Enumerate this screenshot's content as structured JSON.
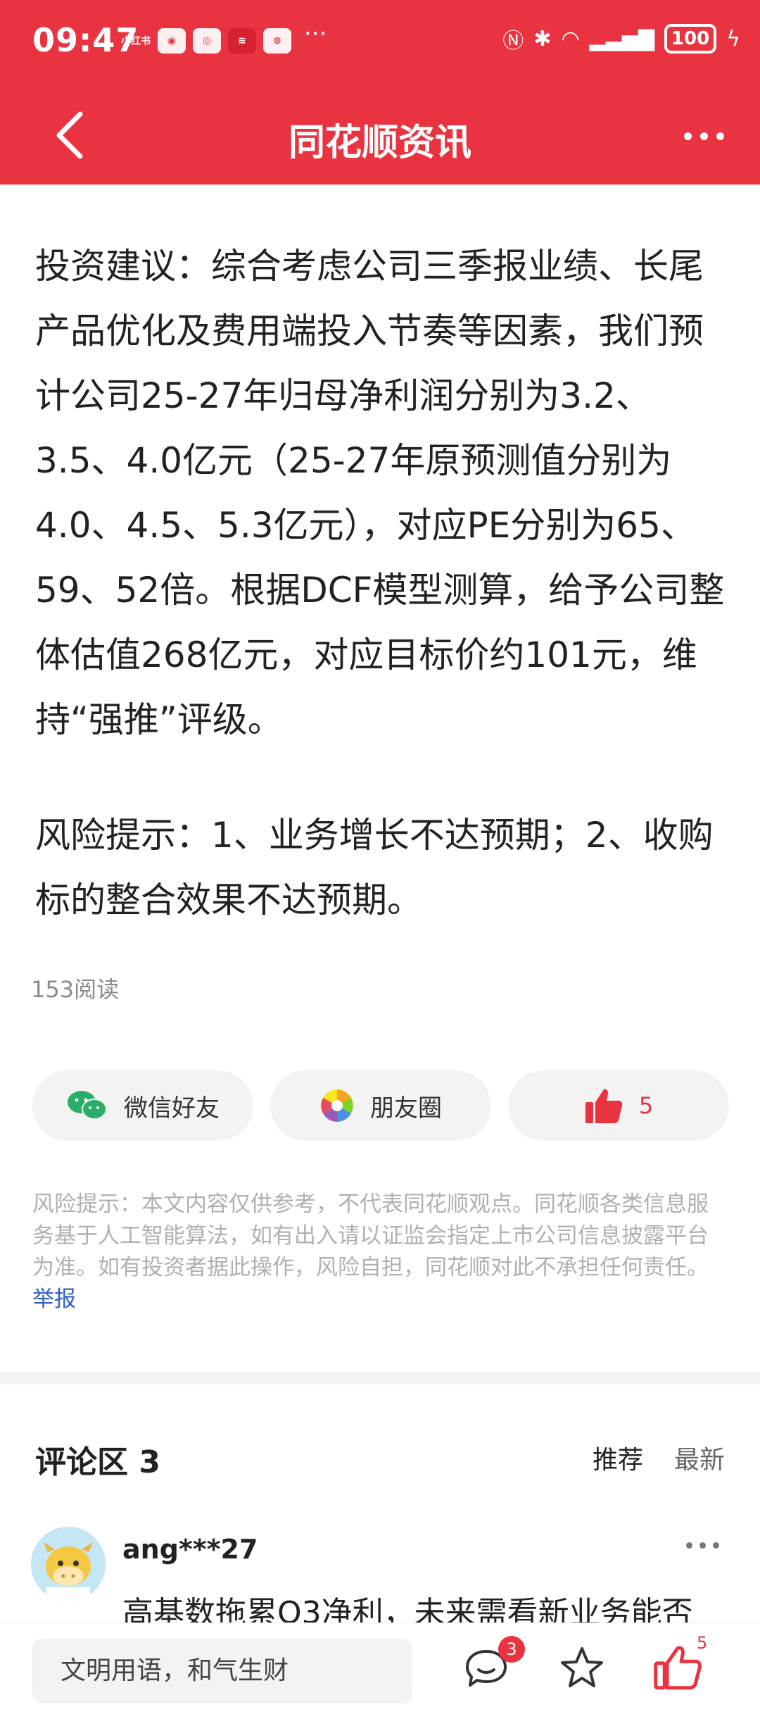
{
  "status_bar": {
    "time": "09:47",
    "notif_label_1": "小红书",
    "more": "···",
    "battery": "100"
  },
  "header": {
    "title": "同花顺资讯"
  },
  "article": {
    "paragraph_1": "投资建议：综合考虑公司三季报业绩、长尾产品优化及费用端投入节奏等因素，我们预计公司25-27年归母净利润分别为3.2、3.5、4.0亿元（25-27年原预测值分别为4.0、4.5、5.3亿元），对应PE分别为65、59、52倍。根据DCF模型测算，给予公司整体估值268亿元，对应目标价约101元，维持“强推”评级。",
    "paragraph_2": "风险提示：1、业务增长不达预期；2、收购标的整合效果不达预期。",
    "read_count": "153阅读"
  },
  "share": {
    "wechat_label": "微信好友",
    "moments_label": "朋友圈",
    "like_count": "5"
  },
  "disclaimer": {
    "text": "风险提示：本文内容仅供参考，不代表同花顺观点。同花顺各类信息服务基于人工智能算法，如有出入请以证监会指定上市公司信息披露平台为准。如有投资者据此操作，风险自担，同花顺对此不承担任何责任。",
    "report_label": "举报"
  },
  "comments": {
    "title": "评论区 3",
    "sort_recommend": "推荐",
    "sort_latest": "最新",
    "items": [
      {
        "username": "ang***27",
        "text": "高基数拖累Q3净利，未来需看新业务能否"
      }
    ]
  },
  "bottom_bar": {
    "input_placeholder": "文明用语，和气生财",
    "comment_badge": "3",
    "like_count": "5"
  },
  "colors": {
    "brand_red": "#e93340",
    "link_blue": "#3060c8"
  },
  "icons": [
    "back-icon",
    "more-icon",
    "wechat-icon",
    "moments-icon",
    "thumbs-up-icon",
    "comment-icon",
    "star-icon"
  ]
}
